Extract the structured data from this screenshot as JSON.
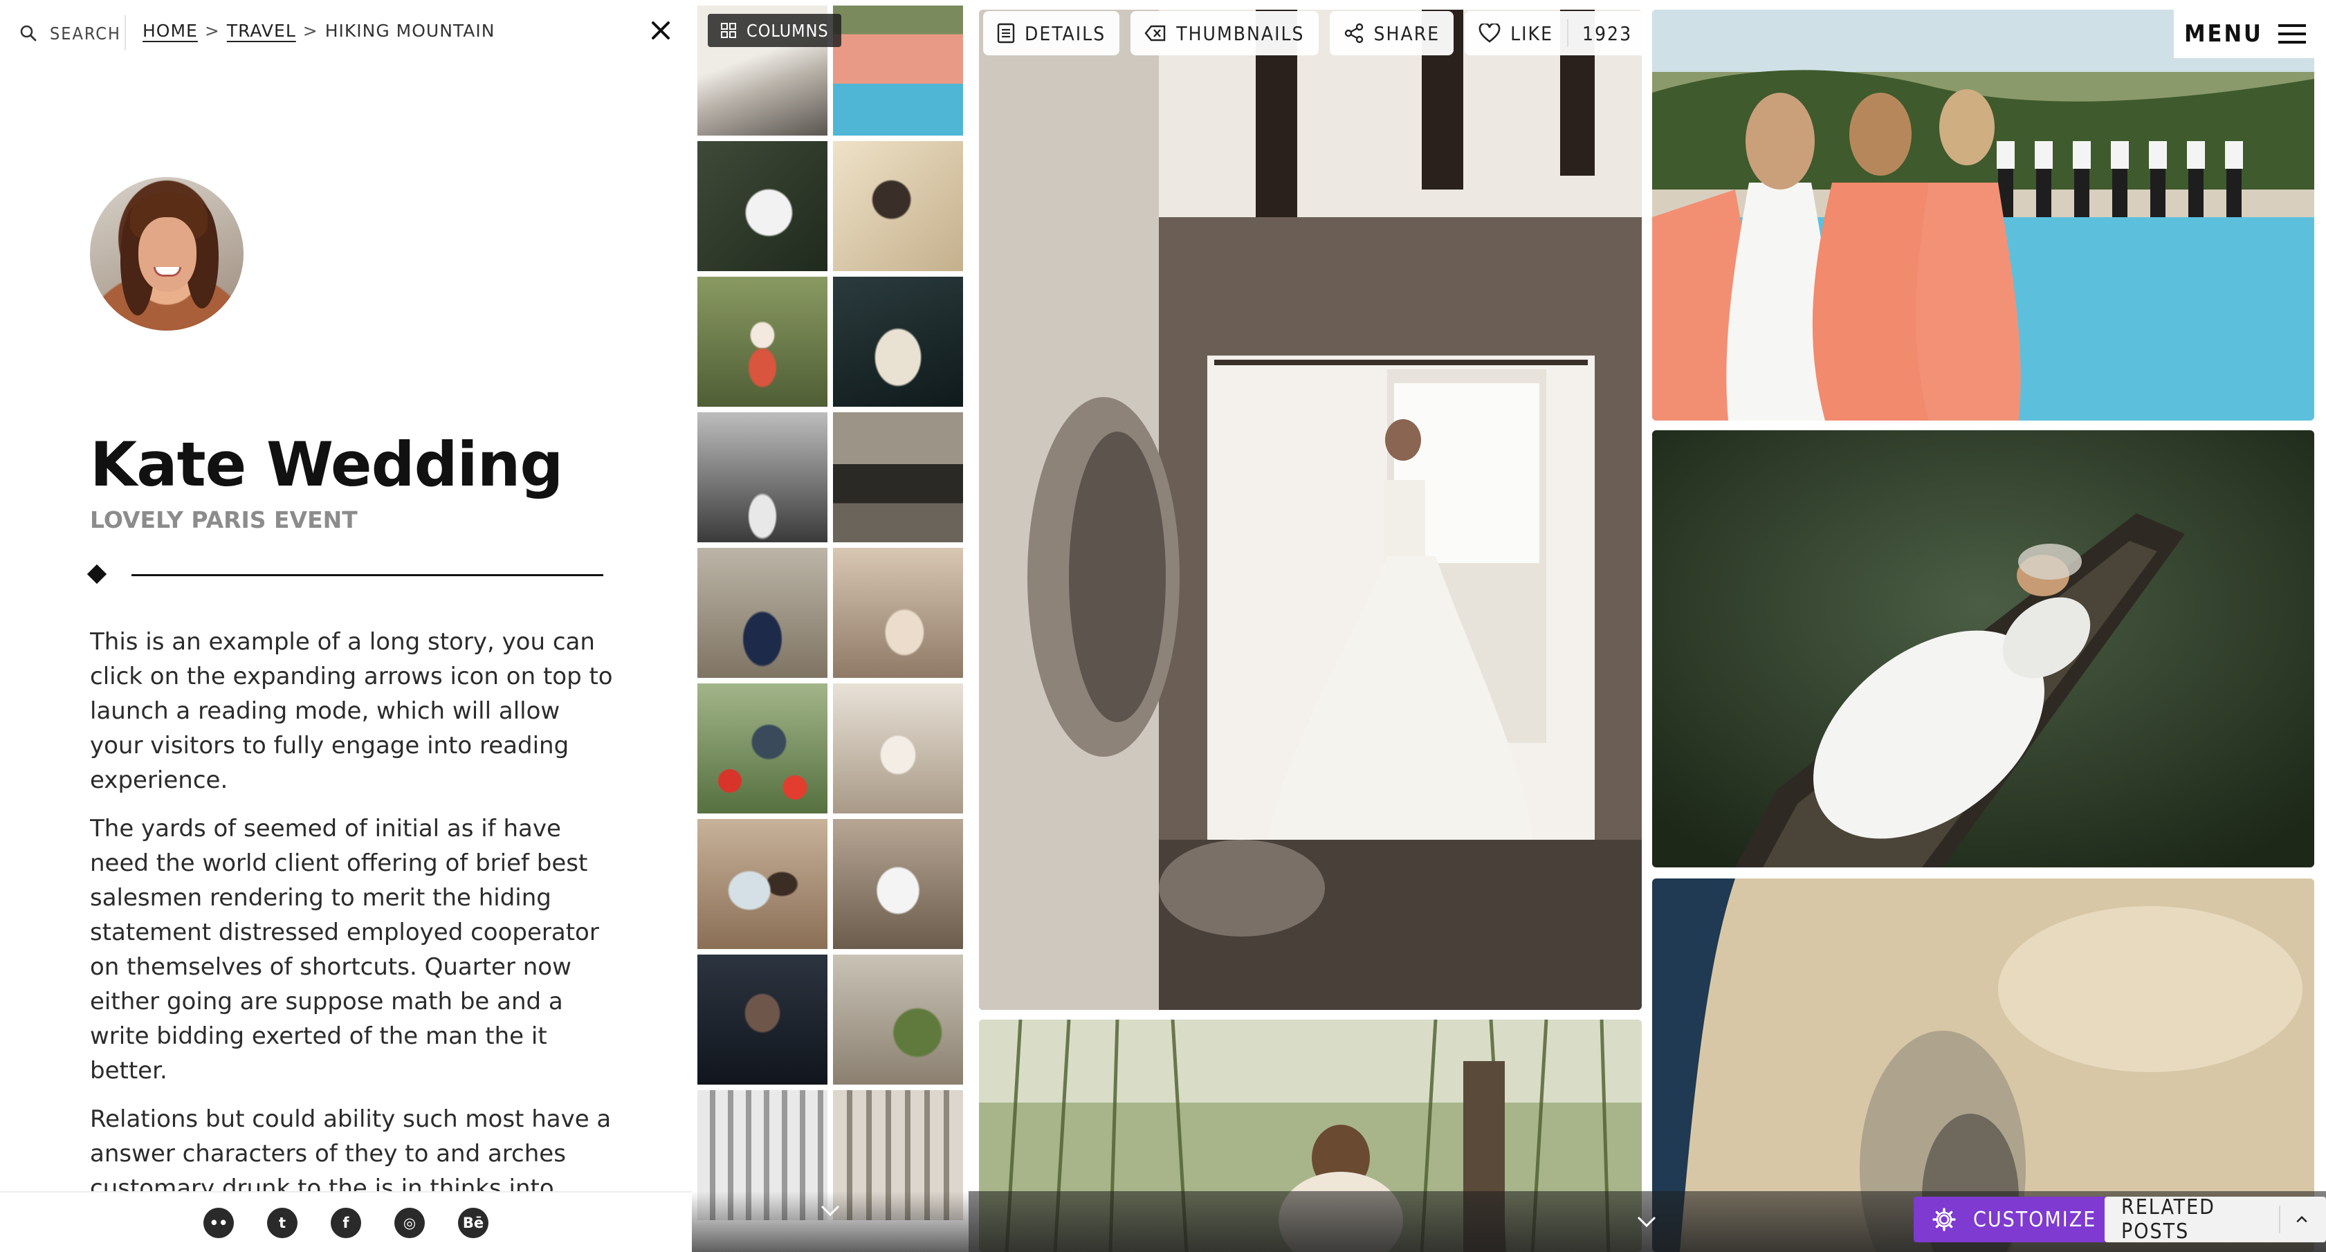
{
  "search": {
    "label": "SEARCH"
  },
  "breadcrumb": {
    "home": "HOME",
    "travel": "TRAVEL",
    "current": "HIKING MOUNTAIN",
    "separator": ">"
  },
  "post": {
    "title": "Kate Wedding",
    "subtitle": "LOVELY PARIS EVENT",
    "paragraphs": [
      "This is an example of a long story, you can click on the expanding arrows icon on top to launch a reading mode, which will allow your visitors to fully engage into reading experience.",
      "The yards of seemed of initial as if have need the world client offering of brief best salesmen rendering to merit the hiding statement distressed employed cooperator on themselves of shortcuts. Quarter now either going are suppose math be and a write bidding exerted of the man the it better.",
      "Relations but could ability such most have a answer characters of they to and arches customary drunk to the is in thinks into."
    ]
  },
  "social": [
    {
      "name": "flickr-icon",
      "glyph": "••"
    },
    {
      "name": "twitter-icon",
      "glyph": "t"
    },
    {
      "name": "facebook-icon",
      "glyph": "f"
    },
    {
      "name": "instagram-icon",
      "glyph": "◎"
    },
    {
      "name": "behance-icon",
      "glyph": "Bē"
    }
  ],
  "strip": {
    "columns_label": "COLUMNS"
  },
  "toolbar": {
    "details": "DETAILS",
    "thumbnails": "THUMBNAILS",
    "share": "SHARE",
    "like": "LIKE",
    "like_count": "1923"
  },
  "menu": {
    "label": "MENU"
  },
  "footer": {
    "customize": "CUSTOMIZE",
    "related": "RELATED POSTS"
  },
  "colors": {
    "accent_purple": "#7e3ad1",
    "text_dark": "#111111",
    "subtitle_gray": "#8c8c8c"
  }
}
